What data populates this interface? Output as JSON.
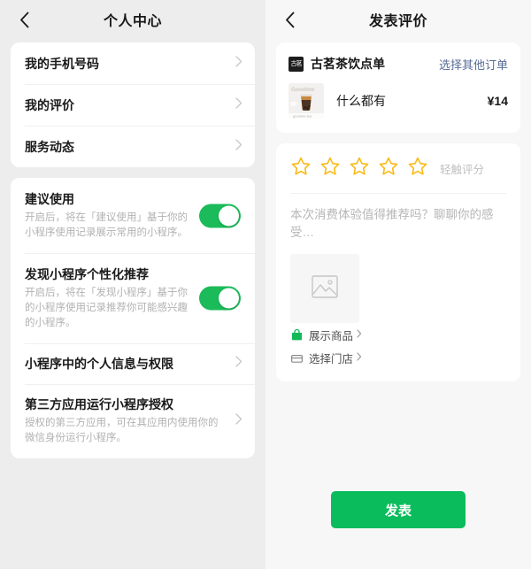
{
  "left": {
    "nav": {
      "back_icon": "chevron-left-icon",
      "title": "个人中心"
    },
    "menu_items": [
      {
        "label": "我的手机号码",
        "chevron": "chevron-right-icon"
      },
      {
        "label": "我的评价",
        "chevron": "chevron-right-icon"
      },
      {
        "label": "服务动态",
        "chevron": "chevron-right-icon"
      }
    ],
    "toggle_items": [
      {
        "title": "建议使用",
        "desc": "开启后，将在「建议使用」基于你的小程序使用记录展示常用的小程序。",
        "state": "on"
      },
      {
        "title": "发现小程序个性化推荐",
        "desc": "开启后，将在「发现小程序」基于你的小程序使用记录推荐你可能感兴趣的小程序。",
        "state": "on"
      }
    ],
    "link_items": [
      {
        "title": "小程序中的个人信息与权限",
        "desc": ""
      },
      {
        "title": "第三方应用运行小程序授权",
        "desc": "授权的第三方应用，可在其应用内使用你的微信身份运行小程序。"
      }
    ]
  },
  "right": {
    "nav": {
      "back_icon": "chevron-left-icon",
      "title": "发表评价"
    },
    "order": {
      "logo_text": "古茗",
      "shop_name": "古茗茶饮点单",
      "change_order_link": "选择其他订单",
      "item_name": "什么都有",
      "item_price": "¥14",
      "thumb_brand": "Goodme"
    },
    "review": {
      "star_count": 5,
      "stars_filled": 0,
      "stars_hint": "轻触评分",
      "text_value": "",
      "text_placeholder": "本次消费体验值得推荐吗？聊聊你的感受…",
      "upload_icon": "image-placeholder-icon",
      "links": [
        {
          "icon": "shopping-bag-icon",
          "label": "展示商品"
        },
        {
          "icon": "store-icon",
          "label": "选择门店"
        }
      ]
    },
    "submit_label": "发表"
  },
  "colors": {
    "brand_green": "#0bbc5c",
    "switch_green": "#1bbb5a",
    "link_blue": "#576b95",
    "star_gold": "#f9ba15",
    "page_bg_left": "#ededed",
    "page_bg_right": "#f7f7f7"
  }
}
